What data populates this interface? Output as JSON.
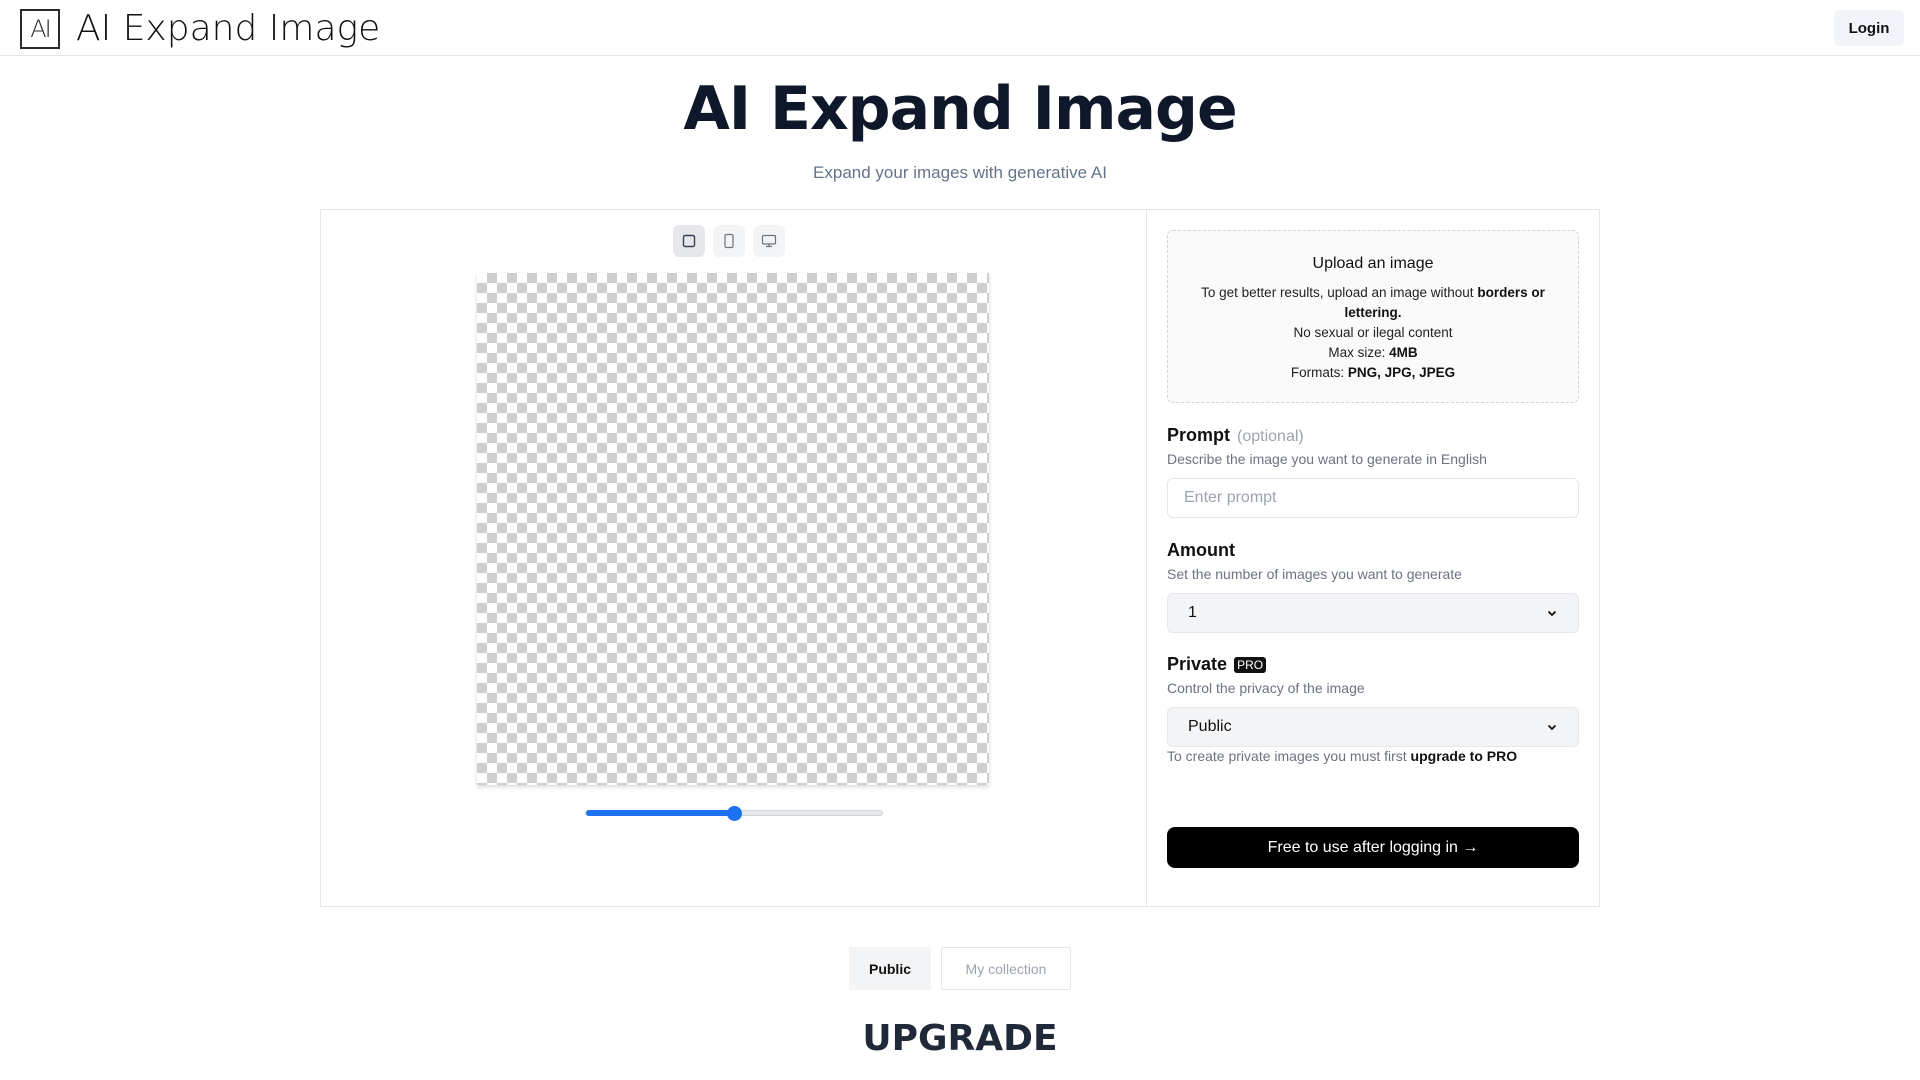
{
  "header": {
    "logo_text": "AI",
    "brand": "AI Expand Image",
    "login_label": "Login"
  },
  "hero": {
    "title": "AI Expand Image",
    "subtitle": "Expand your images with generative AI"
  },
  "editor": {
    "ratio_buttons": [
      {
        "icon": "square-icon",
        "active": true
      },
      {
        "icon": "portrait-icon",
        "active": false
      },
      {
        "icon": "monitor-icon",
        "active": false
      }
    ],
    "zoom_slider_value": 0.5,
    "slider_color": "#1d72f2"
  },
  "upload": {
    "title": "Upload an image",
    "line1_prefix": "To get better results, upload an image without",
    "line1_bold": "borders or lettering.",
    "line2": "No sexual or ilegal content",
    "line3_prefix": "Max size:",
    "line3_bold": "4MB",
    "line4_prefix": "Formats:",
    "line4_bold": "PNG, JPG, JPEG"
  },
  "prompt": {
    "label": "Prompt",
    "optional": "(optional)",
    "description": "Describe the image you want to generate in English",
    "placeholder": "Enter prompt",
    "value": ""
  },
  "amount": {
    "label": "Amount",
    "description": "Set the number of images you want to generate",
    "selected": "1"
  },
  "privacy": {
    "label": "Private",
    "badge": "PRO",
    "description": "Control the privacy of the image",
    "selected": "Public",
    "hint_prefix": "To create private images you must first",
    "hint_bold": "upgrade to PRO"
  },
  "cta_label": "Free to use after logging in →",
  "tabs": [
    {
      "label": "Public",
      "active": true
    },
    {
      "label": "My collection",
      "active": false
    }
  ],
  "upgrade_heading": "UPGRADE"
}
